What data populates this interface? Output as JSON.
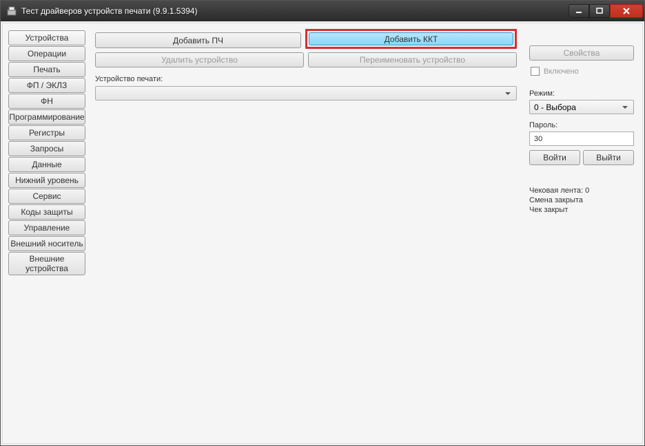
{
  "window": {
    "title": "Тест драйверов устройств печати (9.9.1.5394)"
  },
  "sidebar": {
    "items": [
      {
        "label": "Устройства"
      },
      {
        "label": "Операции"
      },
      {
        "label": "Печать"
      },
      {
        "label": "ФП / ЭКЛЗ"
      },
      {
        "label": "ФН"
      },
      {
        "label": "Программирование"
      },
      {
        "label": "Регистры"
      },
      {
        "label": "Запросы"
      },
      {
        "label": "Данные"
      },
      {
        "label": "Нижний уровень"
      },
      {
        "label": "Сервис"
      },
      {
        "label": "Коды защиты"
      },
      {
        "label": "Управление"
      },
      {
        "label": "Внешний носитель"
      },
      {
        "label": "Внешние\nустройства"
      }
    ]
  },
  "main": {
    "add_pch": "Добавить ПЧ",
    "add_kkt": "Добавить ККТ",
    "delete_device": "Удалить устройство",
    "rename_device": "Переименовать устройство",
    "device_label": "Устройство печати:",
    "device_value": ""
  },
  "right": {
    "properties": "Свойства",
    "enabled_label": "Включено",
    "mode_label": "Режим:",
    "mode_value": "0 - Выбора",
    "password_label": "Пароль:",
    "password_value": "30",
    "login": "Войти",
    "logout": "Выйти",
    "status1": "Чековая лента: 0",
    "status2": "Смена закрыта",
    "status3": "Чек закрыт"
  }
}
